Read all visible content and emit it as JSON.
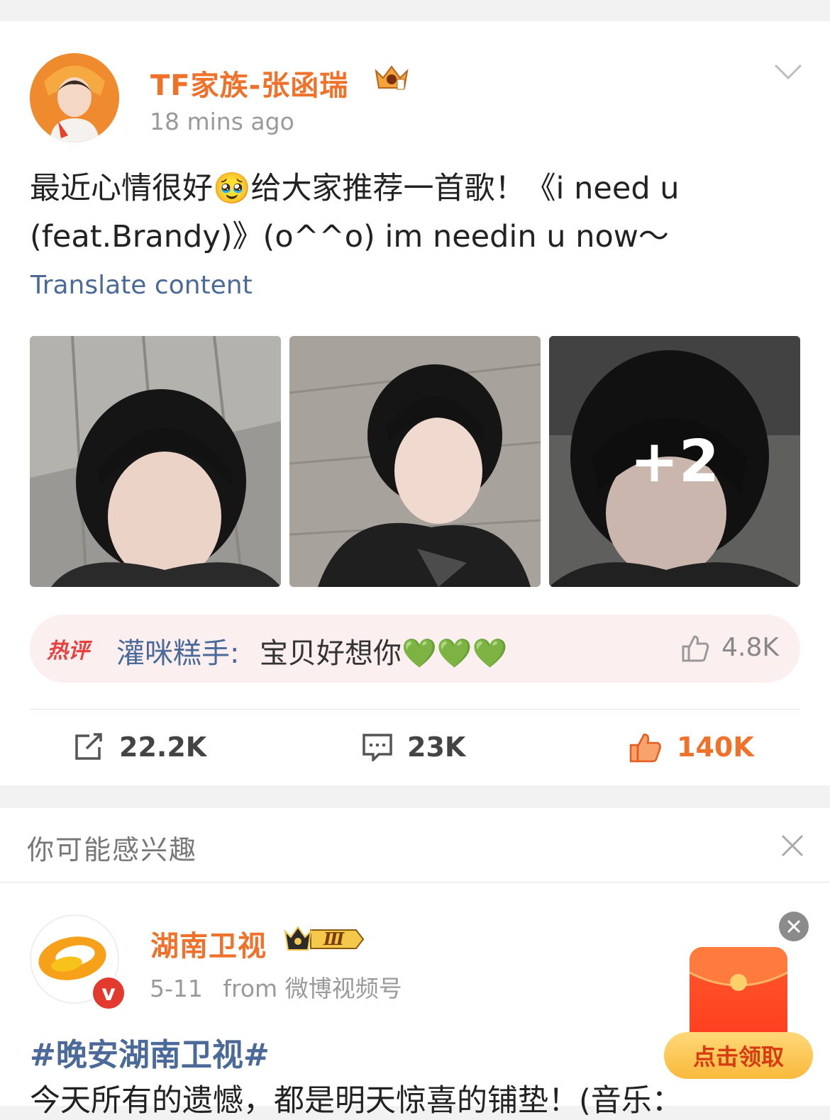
{
  "post1": {
    "author": "TF家族-张函瑞",
    "time": "18 mins ago",
    "text_line1": "最近心情很好🥹给大家推荐一首歌！《i need u",
    "text_line2": "(feat.Brandy)》(o^^o) im needin u now～",
    "translate_label": "Translate content",
    "more_photos": "+2",
    "hot_comment": {
      "badge": "热评",
      "user": "灌咪糕手:",
      "text": "宝贝好想你💚💚💚",
      "likes": "4.8K"
    },
    "actions": {
      "reposts": "22.2K",
      "comments": "23K",
      "likes": "140K"
    }
  },
  "recommend": {
    "title": "你可能感兴趣"
  },
  "post2": {
    "author": "湖南卫视",
    "level_badge": "Ⅲ",
    "date": "5-11",
    "source": "from 微博视频号",
    "verified": "v",
    "hashtag": "#晚安湖南卫视#",
    "text_cut": "今天所有的遗憾，都是明天惊喜的铺垫！(音乐："
  },
  "redpacket": {
    "button": "点击领取"
  },
  "colors": {
    "brand_orange": "#f0712a",
    "link_blue": "#4b6a99",
    "liked": "#f0712a"
  }
}
